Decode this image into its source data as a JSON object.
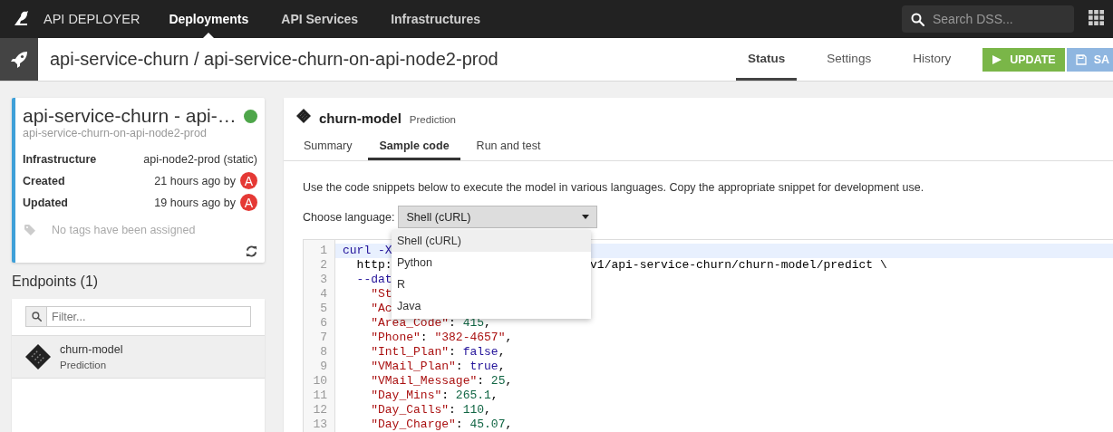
{
  "topbar": {
    "app_name": "API DEPLOYER",
    "nav": [
      {
        "label": "Deployments",
        "selected": true
      },
      {
        "label": "API Services",
        "selected": false
      },
      {
        "label": "Infrastructures",
        "selected": false
      }
    ],
    "search": {
      "placeholder": "Search DSS..."
    }
  },
  "header": {
    "title": "api-service-churn / api-service-churn-on-api-node2-prod",
    "tabs": [
      {
        "label": "Status",
        "selected": true
      },
      {
        "label": "Settings",
        "selected": false
      },
      {
        "label": "History",
        "selected": false
      }
    ],
    "buttons": [
      {
        "kind": "update",
        "label": "UPDATE",
        "disabled": false
      },
      {
        "kind": "save",
        "label": "SA",
        "disabled": true
      }
    ]
  },
  "deployment": {
    "title": "api-service-churn - api-…",
    "subtitle": "api-service-churn-on-api-node2-prod",
    "color": "#4ea64a",
    "fields": [
      {
        "label": "Infrastructure",
        "value": "api-node2-prod (static)"
      },
      {
        "label": "Created",
        "value": "21 hours ago by",
        "avatar": "A"
      },
      {
        "label": "Updated",
        "value": "19 hours ago by",
        "avatar": "A"
      }
    ],
    "tags_placeholder": "No tags have been assigned"
  },
  "endpoints": {
    "title": "Endpoints (1)",
    "filter": {
      "placeholder": "Filter..."
    },
    "items": [
      {
        "name": "churn-model",
        "subtitle": "Prediction",
        "selected": true
      }
    ]
  },
  "endpoint_detail": {
    "name": "churn-model",
    "subtitle": "Prediction",
    "tabs": [
      {
        "label": "Summary",
        "selected": false
      },
      {
        "label": "Sample code",
        "selected": true
      },
      {
        "label": "Run and test",
        "selected": false
      }
    ],
    "description": "Use the code snippets below to execute the model in various languages. Copy the appropriate snippet for development use.",
    "language_label": "Choose language:",
    "language": {
      "value": "Shell (cURL)",
      "expanded": true,
      "options": [
        {
          "label": "Shell (cURL)",
          "selected": true
        },
        {
          "label": "Python",
          "selected": false
        },
        {
          "label": "R",
          "selected": false
        },
        {
          "label": "Java",
          "selected": false
        }
      ]
    },
    "code": {
      "lines": [
        {
          "number": "1",
          "text": "curl -X",
          "highlighted": true
        },
        {
          "number": "2",
          "text": "  http:",
          "tail": "v1/api-service-churn/churn-model/predict \\",
          "highlighted": false
        },
        {
          "number": "3",
          "text": "  --dat",
          "highlighted": false
        },
        {
          "number": "4",
          "text": "    \"St",
          "highlighted": false
        },
        {
          "number": "5",
          "text": "    \"Ac",
          "highlighted": false
        },
        {
          "number": "6",
          "text": "    \"Area_Code\": 415,",
          "highlighted": false
        },
        {
          "number": "7",
          "text": "    \"Phone\": \"382-4657\",",
          "highlighted": false
        },
        {
          "number": "8",
          "text": "    \"Intl_Plan\": false,",
          "highlighted": false
        },
        {
          "number": "9",
          "text": "    \"VMail_Plan\": true,",
          "highlighted": false
        },
        {
          "number": "10",
          "text": "    \"VMail_Message\": 25,",
          "highlighted": false
        },
        {
          "number": "11",
          "text": "    \"Day_Mins\": 265.1,",
          "highlighted": false
        },
        {
          "number": "12",
          "text": "    \"Day_Calls\": 110,",
          "highlighted": false
        },
        {
          "number": "13",
          "text": "    \"Day_Charge\": 45.07,",
          "highlighted": false
        }
      ]
    }
  }
}
